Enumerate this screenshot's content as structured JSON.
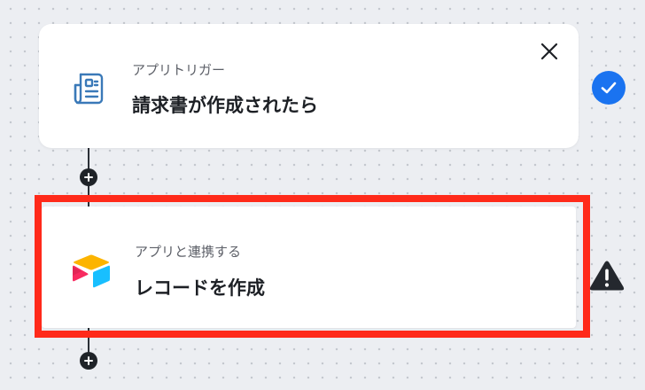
{
  "trigger": {
    "subtitle": "アプリトリガー",
    "title": "請求書が作成されたら",
    "icon": "invoice-document-icon",
    "status_icon": "check-circle-icon",
    "close_icon": "close-icon"
  },
  "action": {
    "subtitle": "アプリと連携する",
    "title": "レコードを作成",
    "icon": "airtable-logo-icon",
    "status_icon": "warning-triangle-icon"
  },
  "flow": {
    "add_step_icon": "plus-icon"
  },
  "colors": {
    "canvas_bg": "#eceef2",
    "highlight": "#ff2a1a",
    "check": "#1a73f0",
    "connector": "#2b2f36",
    "icon_blue": "#3a79b8"
  }
}
